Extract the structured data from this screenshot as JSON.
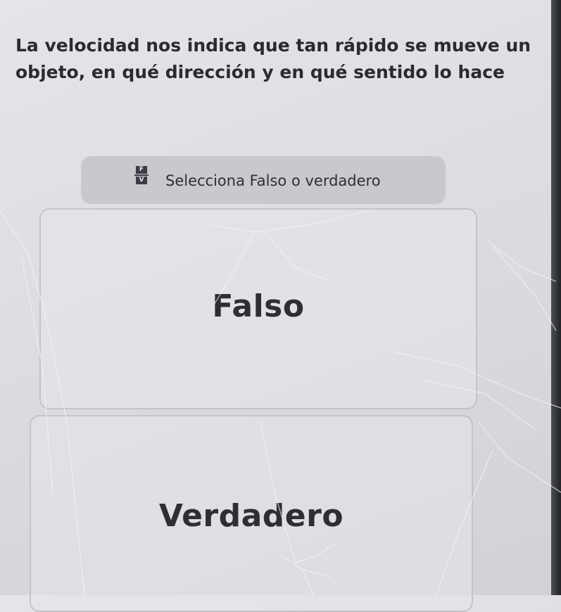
{
  "question": {
    "text": "La velocidad nos indica que tan rápido se mueve un objeto, en qué dirección y en qué sentido lo hace"
  },
  "instruction": {
    "icon": "true-false-icon",
    "icon_top_letter": "F",
    "icon_bottom_letter": "V",
    "text": "Selecciona Falso o verdadero"
  },
  "options": [
    {
      "label": "Falso"
    },
    {
      "label": "Verdadero"
    }
  ],
  "colors": {
    "background": "#dfdde3",
    "instruction_pill": "#c9c8cf",
    "card_border": "#c4c3ca",
    "text": "#2b2b30"
  }
}
